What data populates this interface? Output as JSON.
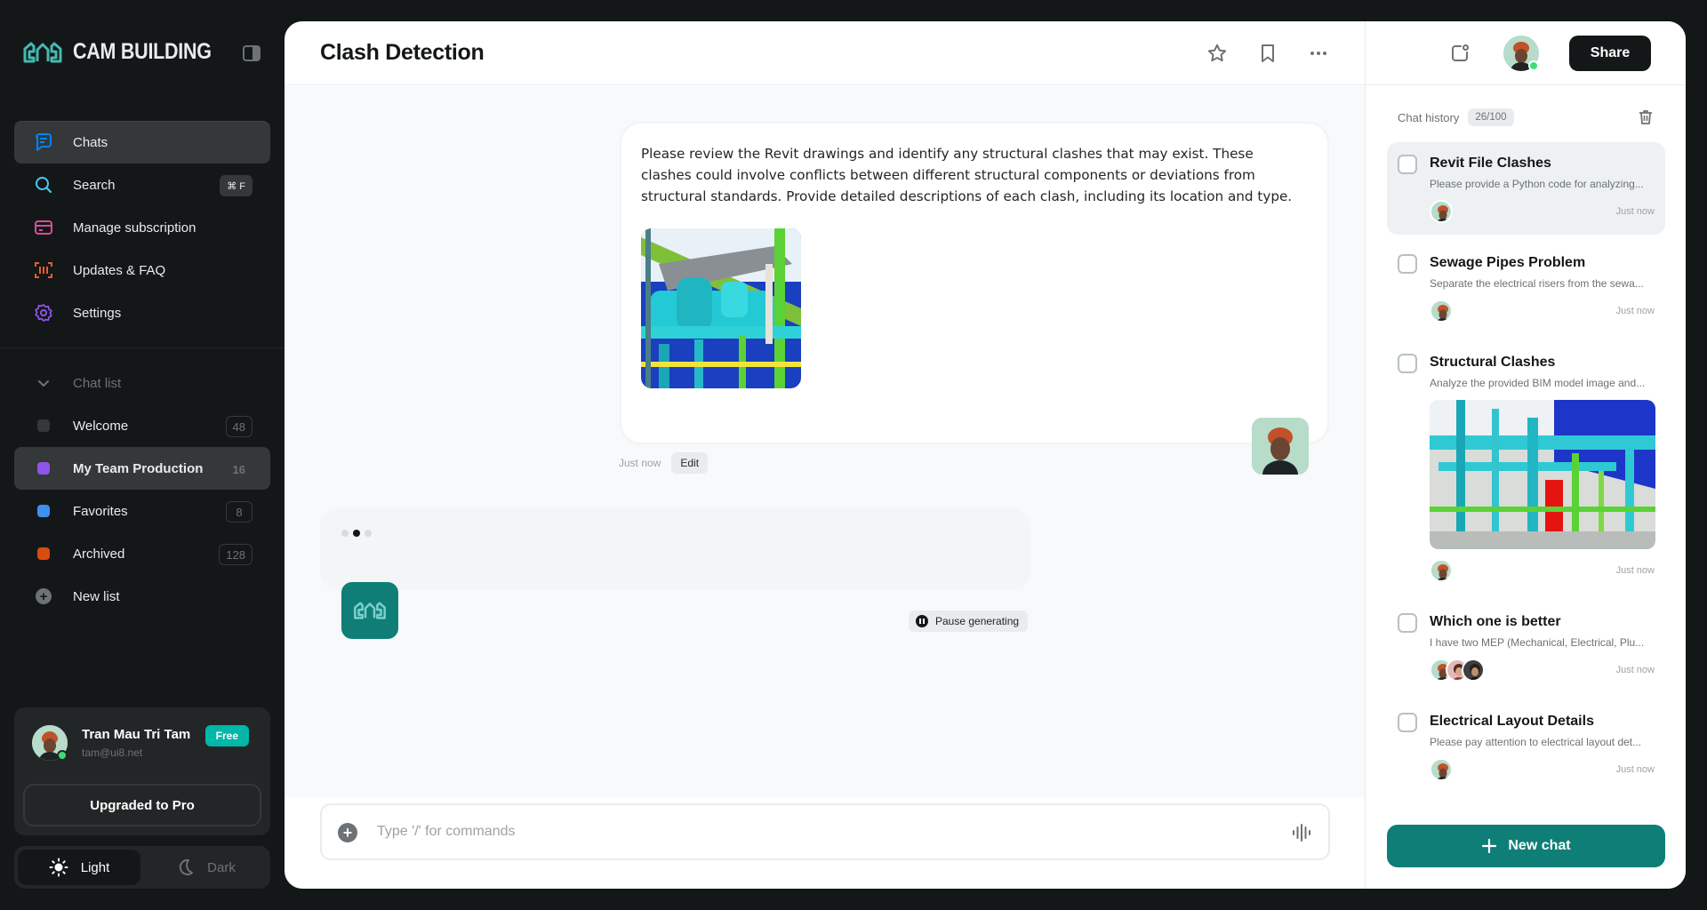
{
  "brand": {
    "name": "CAM BUILDING"
  },
  "nav": {
    "items": [
      {
        "label": "Chats",
        "icon": "chat-icon",
        "color": "#0084ff"
      },
      {
        "label": "Search",
        "icon": "search-icon",
        "color": "#4bc9f0",
        "shortcut": "⌘ F"
      },
      {
        "label": "Manage subscription",
        "icon": "card-icon",
        "color": "#d84c9b"
      },
      {
        "label": "Updates & FAQ",
        "icon": "barcode-icon",
        "color": "#e75d2c"
      },
      {
        "label": "Settings",
        "icon": "gear-icon",
        "color": "#8e55ea"
      }
    ]
  },
  "chat_list": {
    "header": "Chat list",
    "items": [
      {
        "label": "Welcome",
        "count": "48",
        "color": "#343839"
      },
      {
        "label": "My Team Production",
        "count": "16",
        "color": "#8e55ea"
      },
      {
        "label": "Favorites",
        "count": "8",
        "color": "#3e90f0"
      },
      {
        "label": "Archived",
        "count": "128",
        "color": "#d84c10"
      }
    ],
    "new_list": "New list"
  },
  "profile": {
    "name": "Tran Mau Tri Tam",
    "email": "tam@ui8.net",
    "plan": "Free",
    "upgrade": "Upgraded to Pro"
  },
  "theme": {
    "light": "Light",
    "dark": "Dark",
    "active": "Light"
  },
  "chat": {
    "title": "Clash Detection",
    "user_message": "Please review the Revit drawings and identify any structural clashes that may exist. These clashes could involve conflicts between different structural components or deviations from structural standards. Provide detailed descriptions of each clash, including its location and type.",
    "message_time": "Just now",
    "edit": "Edit",
    "pause": "Pause generating",
    "composer_placeholder": "Type '/' for commands"
  },
  "right_panel": {
    "share": "Share",
    "history_label": "Chat history",
    "history_count": "26/100",
    "items": [
      {
        "title": "Revit File Clashes",
        "desc": "Please provide a Python code for analyzing...",
        "time": "Just now"
      },
      {
        "title": "Sewage Pipes Problem",
        "desc": "Separate the electrical risers from the sewa...",
        "time": "Just now"
      },
      {
        "title": "Structural Clashes",
        "desc": "Analyze the provided BIM model image and...",
        "time": "Just now"
      },
      {
        "title": "Which one is better",
        "desc": "I have two MEP (Mechanical, Electrical, Plu...",
        "time": "Just now"
      },
      {
        "title": "Electrical Layout Details",
        "desc": "Please pay attention to electrical layout det...",
        "time": "Just now"
      }
    ],
    "new_chat": "New chat"
  },
  "colors": {
    "accent": "#0f7e77",
    "dark_bg": "#141718",
    "online": "#3fdd78",
    "free_badge": "#00b7a8"
  }
}
